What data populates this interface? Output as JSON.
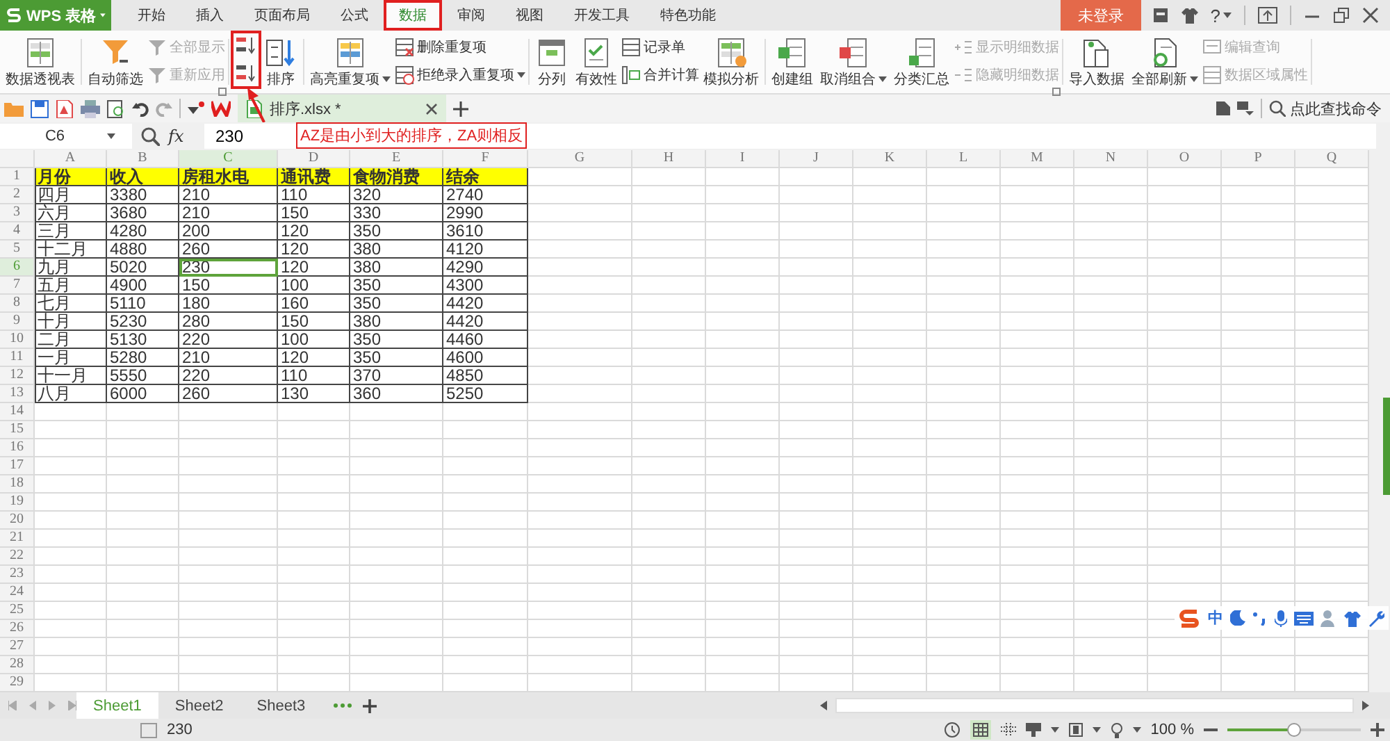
{
  "app": {
    "name": "WPS 表格",
    "login": "未登录",
    "help": "?"
  },
  "menu_tabs": [
    {
      "label": "开始",
      "selected": false,
      "marked": false
    },
    {
      "label": "插入",
      "selected": false,
      "marked": false
    },
    {
      "label": "页面布局",
      "selected": false,
      "marked": false
    },
    {
      "label": "公式",
      "selected": false,
      "marked": false
    },
    {
      "label": "数据",
      "selected": true,
      "marked": true
    },
    {
      "label": "审阅",
      "selected": false,
      "marked": false
    },
    {
      "label": "视图",
      "selected": false,
      "marked": false
    },
    {
      "label": "开发工具",
      "selected": false,
      "marked": false
    },
    {
      "label": "特色功能",
      "selected": false,
      "marked": false
    }
  ],
  "ribbon": [
    {
      "items": [
        {
          "kind": "large",
          "label": "数据透视表",
          "dropdown": false
        }
      ]
    },
    {
      "launcher": true,
      "items": [
        {
          "kind": "large",
          "label": "自动筛选",
          "dropdown": false
        },
        {
          "kind": "stack",
          "items": [
            {
              "label": "全部显示",
              "disabled": true,
              "dropdown": false
            },
            {
              "label": "重新应用",
              "disabled": true,
              "dropdown": false
            }
          ]
        }
      ]
    },
    {
      "items": [
        {
          "kind": "sort-icons",
          "marked": true
        },
        {
          "kind": "large",
          "label": "排序",
          "dropdown": false
        }
      ]
    },
    {
      "items": [
        {
          "kind": "large",
          "label": "高亮重复项",
          "dropdown": true
        },
        {
          "kind": "stack",
          "items": [
            {
              "label": "删除重复项",
              "disabled": false,
              "dropdown": false
            },
            {
              "label": "拒绝录入重复项",
              "disabled": false,
              "dropdown": true
            }
          ]
        }
      ]
    },
    {
      "items": [
        {
          "kind": "large",
          "label": "分列",
          "dropdown": false
        },
        {
          "kind": "large",
          "label": "有效性",
          "dropdown": false
        },
        {
          "kind": "stack",
          "items": [
            {
              "label": "记录单",
              "disabled": false,
              "dropdown": false
            },
            {
              "label": "合并计算",
              "disabled": false,
              "dropdown": false
            }
          ]
        },
        {
          "kind": "large",
          "label": "模拟分析",
          "dropdown": false
        }
      ]
    },
    {
      "launcher": true,
      "items": [
        {
          "kind": "large",
          "label": "创建组",
          "dropdown": false
        },
        {
          "kind": "large",
          "label": "取消组合",
          "dropdown": true
        },
        {
          "kind": "large",
          "label": "分类汇总",
          "dropdown": false
        },
        {
          "kind": "stack",
          "items": [
            {
              "label": "显示明细数据",
              "disabled": true,
              "dropdown": false
            },
            {
              "label": "隐藏明细数据",
              "disabled": true,
              "dropdown": false
            }
          ]
        }
      ]
    },
    {
      "items": [
        {
          "kind": "large",
          "label": "导入数据",
          "dropdown": false
        },
        {
          "kind": "large",
          "label": "全部刷新",
          "dropdown": true
        },
        {
          "kind": "stack",
          "items": [
            {
              "label": "编辑查询",
              "disabled": true,
              "dropdown": false
            },
            {
              "label": "数据区域属性",
              "disabled": true,
              "dropdown": false
            }
          ]
        }
      ]
    }
  ],
  "document_tab": {
    "title": "排序.xlsx *"
  },
  "command_search": {
    "placeholder": "点此查找命令"
  },
  "formula_bar": {
    "cell_ref": "C6",
    "fx": "fx",
    "value": "230"
  },
  "annotation": {
    "text": "AZ是由小到大的排序，ZA则相反"
  },
  "sheet": {
    "columns": [
      {
        "label": "A",
        "selected": false
      },
      {
        "label": "B",
        "selected": false
      },
      {
        "label": "C",
        "selected": true
      },
      {
        "label": "D",
        "selected": false
      },
      {
        "label": "E",
        "selected": false
      },
      {
        "label": "F",
        "selected": false
      },
      {
        "label": "G",
        "selected": false
      },
      {
        "label": "H",
        "selected": false
      },
      {
        "label": "I",
        "selected": false
      },
      {
        "label": "J",
        "selected": false
      },
      {
        "label": "K",
        "selected": false
      },
      {
        "label": "L",
        "selected": false
      },
      {
        "label": "M",
        "selected": false
      },
      {
        "label": "N",
        "selected": false
      },
      {
        "label": "O",
        "selected": false
      },
      {
        "label": "P",
        "selected": false
      },
      {
        "label": "Q",
        "selected": false
      }
    ],
    "rows": [
      {
        "number": "1",
        "selected": false,
        "kind": "header",
        "cells": [
          "月份",
          "收入",
          "房租水电",
          "通讯费",
          "食物消费",
          "结余"
        ]
      },
      {
        "number": "2",
        "selected": false,
        "kind": "data",
        "cells": [
          "四月",
          "3380",
          "210",
          "110",
          "320",
          "2740"
        ]
      },
      {
        "number": "3",
        "selected": false,
        "kind": "data",
        "cells": [
          "六月",
          "3680",
          "210",
          "150",
          "330",
          "2990"
        ]
      },
      {
        "number": "4",
        "selected": false,
        "kind": "data",
        "cells": [
          "三月",
          "4280",
          "200",
          "120",
          "350",
          "3610"
        ]
      },
      {
        "number": "5",
        "selected": false,
        "kind": "data",
        "cells": [
          "十二月",
          "4880",
          "260",
          "120",
          "380",
          "4120"
        ]
      },
      {
        "number": "6",
        "selected": true,
        "kind": "data",
        "cells": [
          "九月",
          "5020",
          "230",
          "120",
          "380",
          "4290"
        ]
      },
      {
        "number": "7",
        "selected": false,
        "kind": "data",
        "cells": [
          "五月",
          "4900",
          "150",
          "100",
          "350",
          "4300"
        ]
      },
      {
        "number": "8",
        "selected": false,
        "kind": "data",
        "cells": [
          "七月",
          "5110",
          "180",
          "160",
          "350",
          "4420"
        ]
      },
      {
        "number": "9",
        "selected": false,
        "kind": "data",
        "cells": [
          "十月",
          "5230",
          "280",
          "150",
          "380",
          "4420"
        ]
      },
      {
        "number": "10",
        "selected": false,
        "kind": "data",
        "cells": [
          "二月",
          "5130",
          "220",
          "100",
          "350",
          "4460"
        ]
      },
      {
        "number": "11",
        "selected": false,
        "kind": "data",
        "cells": [
          "一月",
          "5280",
          "210",
          "120",
          "350",
          "4600"
        ]
      },
      {
        "number": "12",
        "selected": false,
        "kind": "data",
        "cells": [
          "十一月",
          "5550",
          "220",
          "110",
          "370",
          "4850"
        ]
      },
      {
        "number": "13",
        "selected": false,
        "kind": "data",
        "cells": [
          "八月",
          "6000",
          "260",
          "130",
          "360",
          "5250"
        ]
      },
      {
        "number": "14",
        "selected": false
      },
      {
        "number": "15",
        "selected": false
      },
      {
        "number": "16",
        "selected": false
      },
      {
        "number": "17",
        "selected": false
      },
      {
        "number": "18",
        "selected": false
      },
      {
        "number": "19",
        "selected": false
      },
      {
        "number": "20",
        "selected": false
      },
      {
        "number": "21",
        "selected": false
      },
      {
        "number": "22",
        "selected": false
      },
      {
        "number": "23",
        "selected": false
      },
      {
        "number": "24",
        "selected": false
      },
      {
        "number": "25",
        "selected": false
      },
      {
        "number": "26",
        "selected": false
      },
      {
        "number": "27",
        "selected": false
      },
      {
        "number": "28",
        "selected": false
      },
      {
        "number": "29",
        "selected": false
      }
    ]
  },
  "sheet_tabs": [
    {
      "label": "Sheet1",
      "selected": true
    },
    {
      "label": "Sheet2",
      "selected": false
    },
    {
      "label": "Sheet3",
      "selected": false
    }
  ],
  "status_bar": {
    "value": "230",
    "zoom": "100 %",
    "zoom_slider": {
      "level": 0.5
    }
  },
  "ime_toolbar": {
    "mode": "中"
  }
}
